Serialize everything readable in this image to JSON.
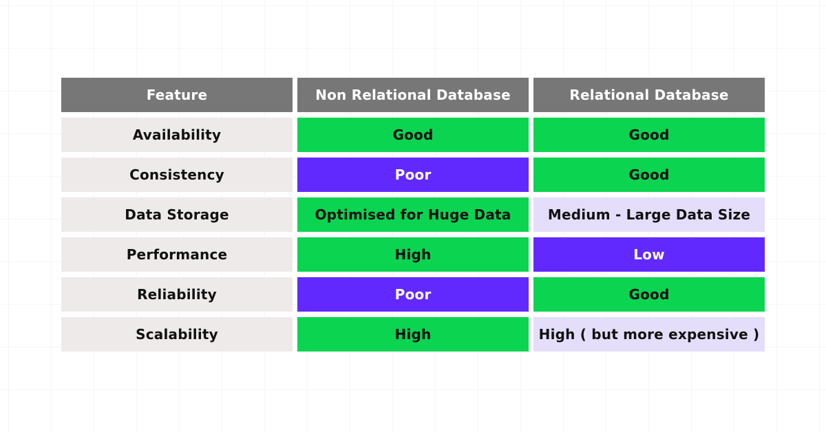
{
  "table": {
    "headers": [
      "Feature",
      "Non Relational Database",
      "Relational Database"
    ],
    "rows": [
      {
        "feature": "Availability",
        "nonrel": "Good",
        "rel": "Good",
        "nonrel_style": "good",
        "rel_style": "good"
      },
      {
        "feature": "Consistency",
        "nonrel": "Poor",
        "rel": "Good",
        "nonrel_style": "poor",
        "rel_style": "good"
      },
      {
        "feature": "Data Storage",
        "nonrel": "Optimised for Huge Data",
        "rel": "Medium - Large Data Size",
        "nonrel_style": "good",
        "rel_style": "med"
      },
      {
        "feature": "Performance",
        "nonrel": "High",
        "rel": "Low",
        "nonrel_style": "good",
        "rel_style": "poor"
      },
      {
        "feature": "Reliability",
        "nonrel": "Poor",
        "rel": "Good",
        "nonrel_style": "poor",
        "rel_style": "good"
      },
      {
        "feature": "Scalability",
        "nonrel": "High",
        "rel": "High ( but more expensive )",
        "nonrel_style": "good",
        "rel_style": "med"
      }
    ]
  },
  "colors": {
    "header_bg": "#777777",
    "feature_bg": "#efeaea",
    "positive": "#0bd451",
    "negative": "#6229ff",
    "neutral": "#e4defb"
  }
}
